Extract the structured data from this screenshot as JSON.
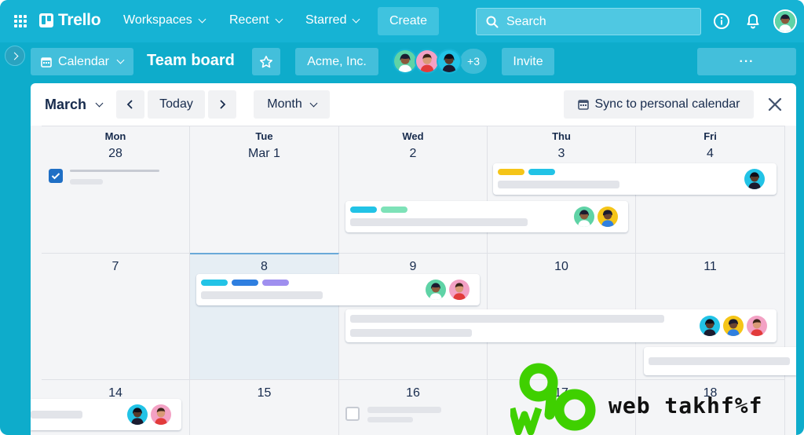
{
  "header": {
    "app_name": "Trello",
    "nav": [
      "Workspaces",
      "Recent",
      "Starred"
    ],
    "create_label": "Create",
    "search_placeholder": "Search",
    "icons": [
      "apps-grid-icon",
      "info-icon",
      "bell-icon",
      "profile-avatar"
    ]
  },
  "board_bar": {
    "view_label": "Calendar",
    "title": "Team board",
    "workspace": "Acme, Inc.",
    "members_more": "+3",
    "invite_label": "Invite",
    "more_label": "···"
  },
  "calendar": {
    "month": "March",
    "today_label": "Today",
    "view_mode": "Month",
    "sync_label": "Sync to personal calendar",
    "weekdays": [
      "Mon",
      "Tue",
      "Wed",
      "Thu",
      "Fri"
    ],
    "weeks": [
      [
        "28",
        "Mar 1",
        "2",
        "3",
        "4"
      ],
      [
        "7",
        "8",
        "9",
        "10",
        "11"
      ],
      [
        "14",
        "15",
        "16",
        "17",
        "18"
      ]
    ]
  },
  "colors": {
    "brand": "#16b3d4",
    "label_cyan": "#22c3e6",
    "label_green": "#7ee2b8",
    "label_yellow": "#f5c518",
    "label_blue": "#2f7fe0",
    "label_purple": "#9f8fef",
    "checkbox_blue": "#1f6fc5"
  },
  "watermark": {
    "logo_text": "90",
    "brand_text": "web takhf%f"
  }
}
